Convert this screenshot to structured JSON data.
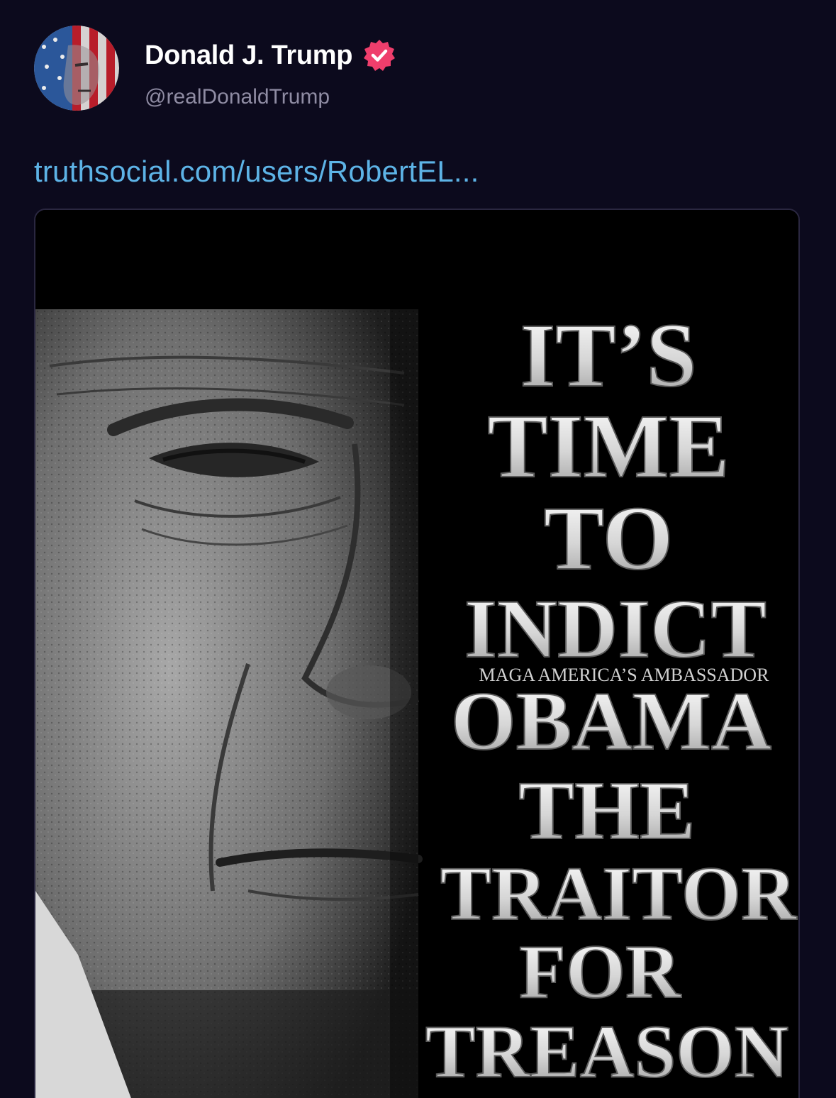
{
  "post": {
    "author": {
      "display_name": "Donald J. Trump",
      "handle": "@realDonaldTrump",
      "verified": true,
      "avatar_icon": "flag-face-avatar",
      "verified_icon": "verified-badge-icon",
      "verified_color": "#ef3e6c"
    },
    "link_text": "truthsocial.com/users/RobertEL...",
    "link_color": "#5db3e6",
    "image": {
      "headline_lines": [
        "IT’S",
        "TIME",
        "TO",
        "INDICT",
        "OBAMA",
        "THE",
        "TRAITOR",
        "FOR",
        "TREASON"
      ],
      "subtitle": "MAGA AMERICA’S AMBASSADOR"
    }
  },
  "theme": {
    "background": "#0c0a1d",
    "name_color": "#ffffff",
    "handle_color": "#8f8ca3"
  }
}
